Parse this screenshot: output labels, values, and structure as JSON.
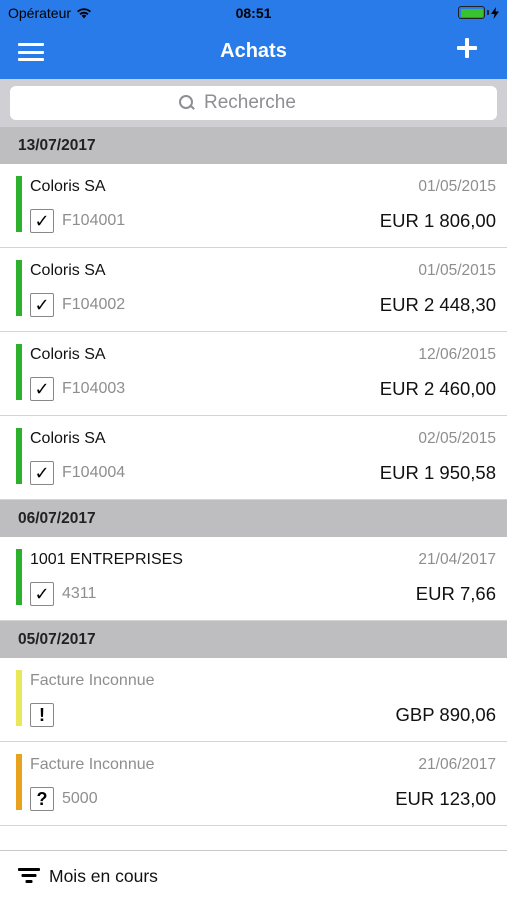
{
  "status_bar": {
    "carrier": "Opérateur",
    "time": "08:51"
  },
  "nav": {
    "title": "Achats",
    "menu_icon": "hamburger-menu-icon",
    "add_icon": "plus-icon"
  },
  "search": {
    "placeholder": "Recherche"
  },
  "colors": {
    "primary": "#2a7bea",
    "status_green": "#2db12d",
    "status_yellow": "#e8e85a",
    "status_orange": "#e8a21e"
  },
  "sections": [
    {
      "date": "13/07/2017",
      "items": [
        {
          "name": "Coloris SA",
          "date": "01/05/2015",
          "reference": "F104001",
          "amount": "EUR 1 806,00",
          "status_icon": "✓",
          "status": "validated"
        },
        {
          "name": "Coloris SA",
          "date": "01/05/2015",
          "reference": "F104002",
          "amount": "EUR 2 448,30",
          "status_icon": "✓",
          "status": "validated"
        },
        {
          "name": "Coloris SA",
          "date": "12/06/2015",
          "reference": "F104003",
          "amount": "EUR 2 460,00",
          "status_icon": "✓",
          "status": "validated"
        },
        {
          "name": "Coloris SA",
          "date": "02/05/2015",
          "reference": "F104004",
          "amount": "EUR 1 950,58",
          "status_icon": "✓",
          "status": "validated"
        }
      ]
    },
    {
      "date": "06/07/2017",
      "items": [
        {
          "name": "1001 ENTREPRISES",
          "date": "21/04/2017",
          "reference": "4311",
          "amount": "EUR 7,66",
          "status_icon": "✓",
          "status": "validated"
        }
      ]
    },
    {
      "date": "05/07/2017",
      "items": [
        {
          "name": "Facture Inconnue",
          "date": "",
          "reference": "",
          "amount": "GBP 890,06",
          "status_icon": "!",
          "status": "warning"
        },
        {
          "name": "Facture Inconnue",
          "date": "21/06/2017",
          "reference": "5000",
          "amount": "EUR 123,00",
          "status_icon": "?",
          "status": "unknown"
        }
      ]
    }
  ],
  "toolbar": {
    "filter_label": "Mois en cours",
    "filter_icon": "filter-icon"
  }
}
